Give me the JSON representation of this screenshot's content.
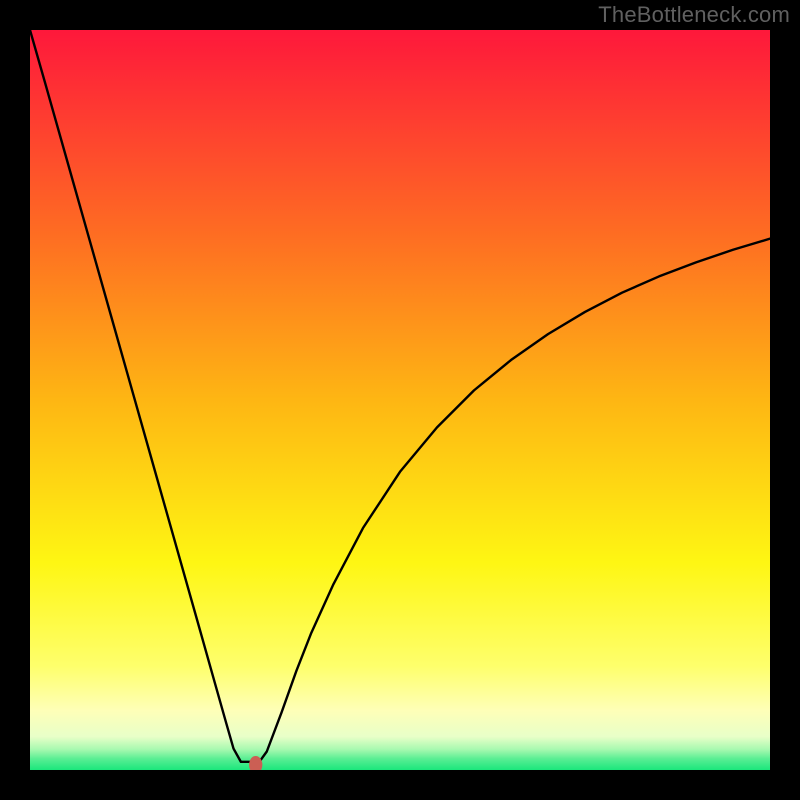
{
  "watermark": "TheBottleneck.com",
  "chart_data": {
    "type": "line",
    "title": "",
    "xlabel": "",
    "ylabel": "",
    "xlim": [
      0,
      100
    ],
    "ylim": [
      0,
      100
    ],
    "grid": false,
    "legend": false,
    "background_gradient": {
      "top_color": "#fe183b",
      "mid1_color": "#fe9d17",
      "mid2_color": "#fef613",
      "band_color": "#feffb8",
      "bottom_color": "#1be77c"
    },
    "series": [
      {
        "name": "bottleneck-curve",
        "color": "#000000",
        "x": [
          0,
          2,
          5,
          8,
          11,
          14,
          17,
          20,
          23,
          25,
          26.5,
          27.5,
          28.5,
          30.5,
          31,
          32,
          34,
          36,
          38,
          41,
          45,
          50,
          55,
          60,
          65,
          70,
          75,
          80,
          85,
          90,
          95,
          100
        ],
        "y": [
          100,
          93,
          82.4,
          71.8,
          61.2,
          50.6,
          40,
          29.4,
          18.8,
          11.7,
          6.4,
          2.9,
          1.1,
          1.1,
          1.1,
          2.5,
          7.8,
          13.4,
          18.5,
          25.1,
          32.7,
          40.3,
          46.3,
          51.3,
          55.4,
          58.9,
          61.9,
          64.5,
          66.7,
          68.6,
          70.3,
          71.8
        ]
      }
    ],
    "marker": {
      "name": "optimal-point",
      "shape": "ellipse",
      "x": 30.5,
      "y": 0.7,
      "color": "#cb5f54",
      "rx": 0.9,
      "ry": 1.2
    }
  }
}
